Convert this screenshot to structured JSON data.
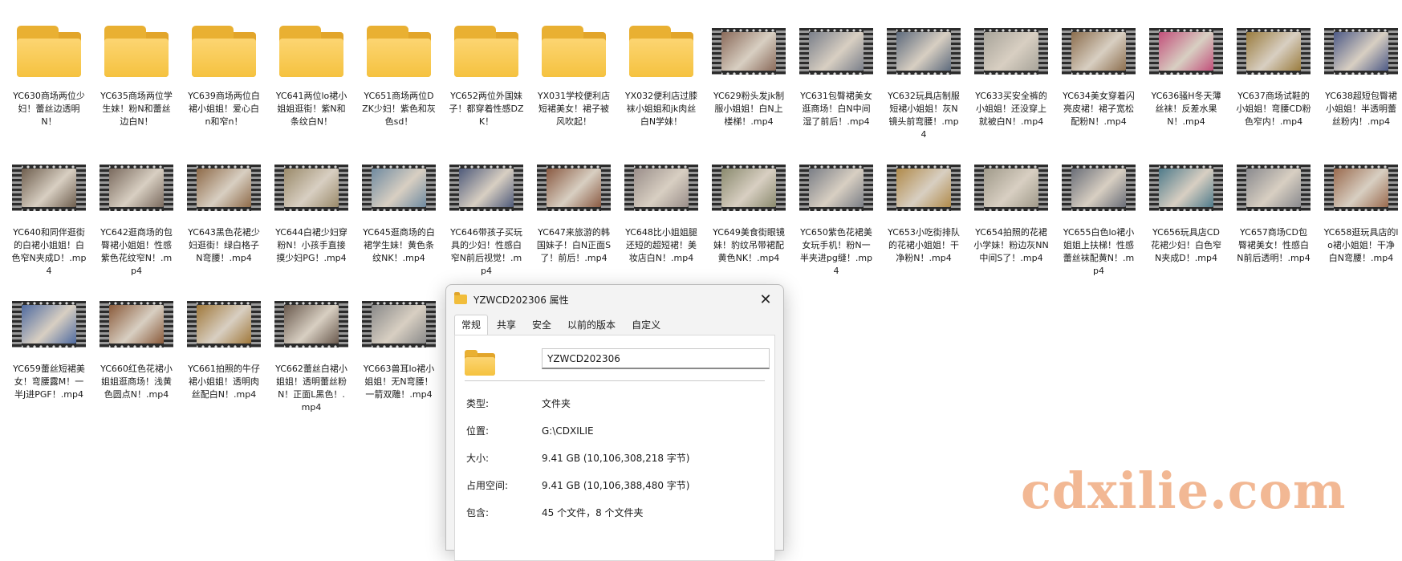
{
  "files": [
    {
      "type": "folder",
      "label": "YC630商场两位少妇！蕾丝边透明N！"
    },
    {
      "type": "folder",
      "label": "YC635商场两位学生妹！粉N和蕾丝边白N！"
    },
    {
      "type": "folder",
      "label": "YC639商场两位白裙小姐姐！爱心白n和窄n！"
    },
    {
      "type": "folder",
      "label": "YC641两位lo裙小姐姐逛街！紫N和条纹白N！"
    },
    {
      "type": "folder",
      "label": "YC651商场两位DZK少妇！紫色和灰色sd！"
    },
    {
      "type": "folder",
      "label": "YC652两位外国妹子！都穿着性感DZK！"
    },
    {
      "type": "folder",
      "label": "YX031学校便利店短裙美女！裙子被风吹起！"
    },
    {
      "type": "folder",
      "label": "YX032便利店过膝袜小姐姐和jk肉丝白N学妹！"
    },
    {
      "type": "video",
      "label": "YC629粉头发jk制服小姐姐！白N上楼梯！.mp4",
      "color": "#8a6a5a"
    },
    {
      "type": "video",
      "label": "YC631包臀裙美女逛商场！白N中间湿了前后！.mp4",
      "color": "#7a7f8a"
    },
    {
      "type": "video",
      "label": "YC632玩具店制服短裙小姐姐！灰N镜头前弯腰！.mp4",
      "color": "#5d6a7c"
    },
    {
      "type": "video",
      "label": "YC633买安全裤的小姐姐！还没穿上就被白N！.mp4",
      "color": "#a8a49a"
    },
    {
      "type": "video",
      "label": "YC634美女穿着闪亮皮裙！裙子宽松配粉N！.mp4",
      "color": "#8c6e4e"
    },
    {
      "type": "video",
      "label": "YC636骚H冬天薄丝袜！反差水果N！.mp4",
      "color": "#c24f7a"
    },
    {
      "type": "video",
      "label": "YC637商场试鞋的小姐姐！弯腰CD粉色窄内！.mp4",
      "color": "#9a7c3e"
    },
    {
      "type": "video",
      "label": "YC638超短包臀裙小姐姐！半透明蕾丝粉内！.mp4",
      "color": "#4d5a86"
    },
    {
      "type": "video",
      "label": "YC640和同伴逛街的白裙小姐姐！白色窄N夹成D！.mp4",
      "color": "#6e5e4e"
    },
    {
      "type": "video",
      "label": "YC642逛商场的包臀裙小姐姐！性感紫色花纹窄N！.mp4",
      "color": "#7a6a5e"
    },
    {
      "type": "video",
      "label": "YC643黑色花裙少妇逛街！绿白格子N弯腰！.mp4",
      "color": "#8e6a48"
    },
    {
      "type": "video",
      "label": "YC644白裙少妇穿粉N！小孩手直接摸少妇PG！.mp4",
      "color": "#9a8a6a"
    },
    {
      "type": "video",
      "label": "YC645逛商场的白裙学生妹！黄色条纹NK！.mp4",
      "color": "#6f8aa0"
    },
    {
      "type": "video",
      "label": "YC646带孩子买玩具的少妇！性感白窄N前后视觉！.mp4",
      "color": "#4e5a7a"
    },
    {
      "type": "video",
      "label": "YC647来旅游的韩国妹子！白N正面S了！前后！.mp4",
      "color": "#8a5a42"
    },
    {
      "type": "video",
      "label": "YC648比小姐姐腿还短的超短裙！美妆店白N！.mp4",
      "color": "#9a8e8a"
    },
    {
      "type": "video",
      "label": "YC649美食街眼镜妹！豹纹吊带裙配黄色NK！.mp4",
      "color": "#8a8a6e"
    },
    {
      "type": "video",
      "label": "YC650紫色花裙美女玩手机！粉N一半夹进pg缝！.mp4",
      "color": "#7a7e86"
    },
    {
      "type": "video",
      "label": "YC653小吃街排队的花裙小姐姐！干净粉N！.mp4",
      "color": "#b08a4a"
    },
    {
      "type": "video",
      "label": "YC654拍照的花裙小学妹！粉边灰NN中间S了！.mp4",
      "color": "#a09a8a"
    },
    {
      "type": "video",
      "label": "YC655白色lo裙小姐姐上扶梯！性感蕾丝袜配黄N！.mp4",
      "color": "#6a6e78"
    },
    {
      "type": "video",
      "label": "YC656玩具店CD花裙少妇！白色窄N夹成D！.mp4",
      "color": "#4e7a8a"
    },
    {
      "type": "video",
      "label": "YC657商场CD包臀裙美女！性感白N前后透明！.mp4",
      "color": "#8a8a8e"
    },
    {
      "type": "video",
      "label": "YC658逛玩具店的lo裙小姐姐！干净白N弯腰！.mp4",
      "color": "#9a6a4e"
    },
    {
      "type": "video",
      "label": "YC659蕾丝短裙美女！弯腰露M！一半J进PGF！.mp4",
      "color": "#4e6aa0"
    },
    {
      "type": "video",
      "label": "YC660红色花裙小姐姐逛商场！浅黄色圆点N！.mp4",
      "color": "#8a5a3a"
    },
    {
      "type": "video",
      "label": "YC661拍照的牛仔裙小姐姐！透明肉丝配白N！.mp4",
      "color": "#a0783a"
    },
    {
      "type": "video",
      "label": "YC662蕾丝白裙小姐姐！透明蕾丝粉N！正面L黑色！.mp4",
      "color": "#6a5a4e"
    },
    {
      "type": "video",
      "label": "YC663兽耳lo裙小姐姐！无N弯腰！一箭双雕！.mp4",
      "color": "#8a8a8a"
    }
  ],
  "dialog": {
    "title": "YZWCD202306 属性",
    "close": "✕",
    "tabs": [
      "常规",
      "共享",
      "安全",
      "以前的版本",
      "自定义"
    ],
    "name_value": "YZWCD202306",
    "rows": [
      {
        "key": "类型:",
        "value": "文件夹"
      },
      {
        "key": "位置:",
        "value": "G:\\CDXILIE"
      },
      {
        "key": "大小:",
        "value": "9.41 GB (10,106,308,218 字节)"
      },
      {
        "key": "占用空间:",
        "value": "9.41 GB (10,106,388,480 字节)"
      },
      {
        "key": "包含:",
        "value": "45 个文件，8 个文件夹"
      }
    ]
  },
  "watermark": "cdxilie.com"
}
